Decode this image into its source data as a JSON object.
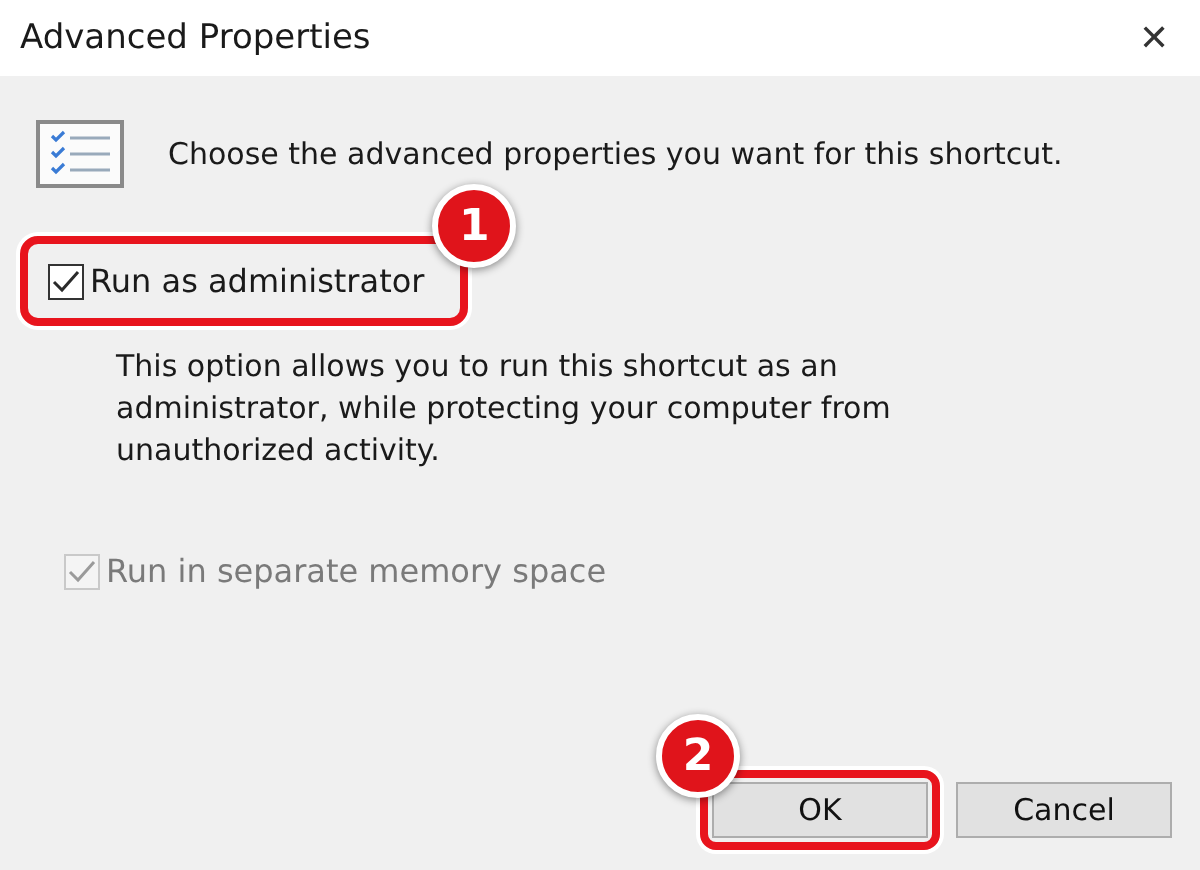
{
  "window": {
    "title": "Advanced Properties",
    "close": "✕"
  },
  "intro": "Choose the advanced properties you want for this shortcut.",
  "options": [
    {
      "label": "Run as administrator",
      "checked": true,
      "disabled": false,
      "highlighted": true,
      "callout": "1",
      "description": "This option allows you to run this shortcut as an administrator, while protecting your computer from unauthorized activity."
    },
    {
      "label": "Run in separate memory space",
      "checked": true,
      "disabled": true,
      "highlighted": false
    }
  ],
  "buttons": [
    {
      "label": "OK",
      "highlighted": true,
      "callout": "2"
    },
    {
      "label": "Cancel",
      "highlighted": false
    }
  ]
}
